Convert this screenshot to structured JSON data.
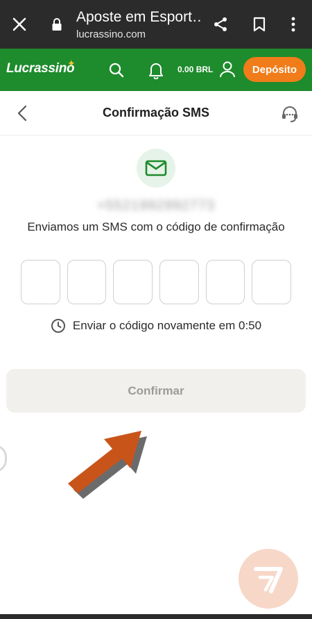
{
  "browser": {
    "title": "Aposte em Esport…",
    "url": "lucrassino.com",
    "icons": [
      "close-icon",
      "lock-icon",
      "share-icon",
      "bookmark-icon",
      "more-vertical-icon"
    ]
  },
  "header": {
    "logo": "Lucrassino",
    "balance": "0.00 BRL",
    "deposit_label": "Depósito",
    "colors": {
      "brand_green": "#1e8b2c",
      "accent_orange": "#f07c1a"
    }
  },
  "page": {
    "title": "Confirmação SMS"
  },
  "verification": {
    "phone": "+5521992992773",
    "sent_text": "Enviamos um SMS com o código de confirmação",
    "code_digits": [
      "",
      "",
      "",
      "",
      "",
      ""
    ],
    "resend_text": "Enviar o código novamente em 0:50",
    "confirm_label": "Confirmar"
  }
}
